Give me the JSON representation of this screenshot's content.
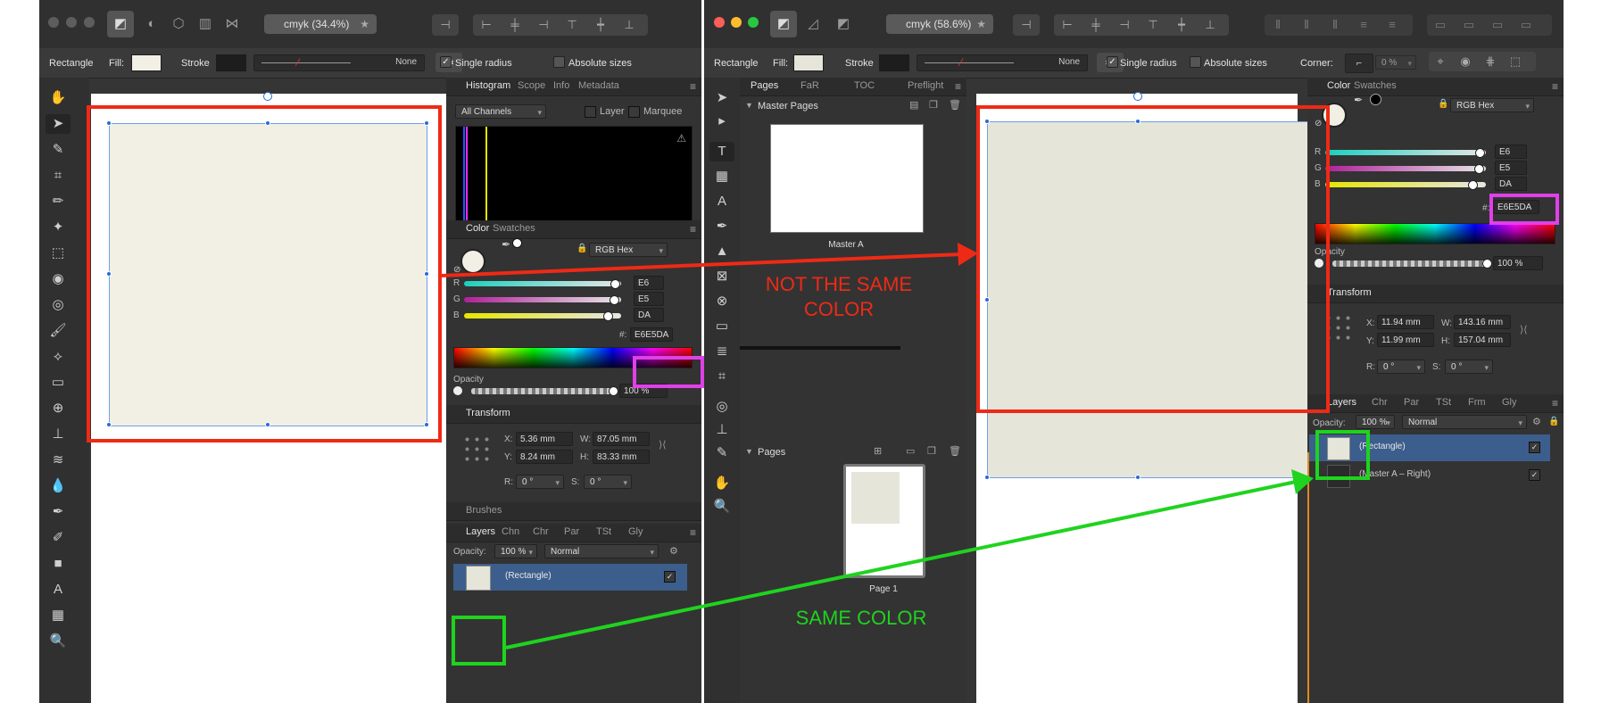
{
  "left_window": {
    "doc_tab": "cmyk (34.4%)",
    "context_bar": {
      "shape": "Rectangle",
      "fill_label": "Fill:",
      "stroke_label": "Stroke",
      "stroke_none": "None",
      "single_radius": "Single radius",
      "absolute_sizes": "Absolute sizes"
    },
    "histogram_panel": {
      "tabs": [
        "Histogram",
        "Scope",
        "Info",
        "Metadata"
      ],
      "channels": "All Channels",
      "layer_label": "Layer",
      "marquee_label": "Marquee"
    },
    "color_panel": {
      "tabs": [
        "Color",
        "Swatches"
      ],
      "mode": "RGB Hex",
      "r_label": "R",
      "g_label": "G",
      "b_label": "B",
      "r": "E6",
      "g": "E5",
      "b": "DA",
      "hex_prefix": "#:",
      "hex": "E6E5DA",
      "opacity_label": "Opacity",
      "opacity": "100 %"
    },
    "transform_panel": {
      "title": "Transform",
      "x_label": "X:",
      "x": "5.36 mm",
      "y_label": "Y:",
      "y": "8.24 mm",
      "w_label": "W:",
      "w": "87.05 mm",
      "h_label": "H:",
      "h": "83.33 mm",
      "r_label": "R:",
      "r": "0 °",
      "s_label": "S:",
      "s": "0 °"
    },
    "brushes_title": "Brushes",
    "layers_panel": {
      "tabs": [
        "Layers",
        "Chn",
        "Chr",
        "Par",
        "TSt",
        "Gly"
      ],
      "opacity_label": "Opacity:",
      "opacity": "100 %",
      "blend": "Normal",
      "rows": [
        {
          "name": "(Rectangle)"
        }
      ]
    }
  },
  "right_window": {
    "doc_tab": "cmyk (58.6%)",
    "context_bar": {
      "shape": "Rectangle",
      "fill_label": "Fill:",
      "stroke_label": "Stroke",
      "stroke_none": "None",
      "single_radius": "Single radius",
      "absolute_sizes": "Absolute sizes",
      "corner_label": "Corner:",
      "corner_value": "0 %"
    },
    "pages_panel": {
      "tabs": [
        "Pages",
        "FaR",
        "TOC",
        "Preflight"
      ],
      "master_section": "Master Pages",
      "master_name": "Master A",
      "pages_section": "Pages",
      "page_name": "Page 1"
    },
    "color_panel": {
      "tabs": [
        "Color",
        "Swatches"
      ],
      "mode": "RGB Hex",
      "r_label": "R",
      "g_label": "G",
      "b_label": "B",
      "r": "E6",
      "g": "E5",
      "b": "DA",
      "hex_prefix": "#:",
      "hex": "E6E5DA",
      "opacity_label": "Opacity",
      "opacity": "100 %"
    },
    "transform_panel": {
      "title": "Transform",
      "x_label": "X:",
      "x": "11.94 mm",
      "y_label": "Y:",
      "y": "11.99 mm",
      "w_label": "W:",
      "w": "143.16 mm",
      "h_label": "H:",
      "h": "157.04 mm",
      "r_label": "R:",
      "r": "0 °",
      "s_label": "S:",
      "s": "0 °"
    },
    "layers_panel": {
      "tabs": [
        "Layers",
        "Chr",
        "Par",
        "TSt",
        "Frm",
        "Gly"
      ],
      "opacity_label": "Opacity:",
      "opacity": "100 %",
      "blend": "Normal",
      "rows": [
        {
          "name": "(Rectangle)"
        },
        {
          "name": "(Master A – Right)"
        }
      ]
    }
  },
  "annotations": {
    "not_same_line1": "NOT THE SAME",
    "not_same_line2": "COLOR",
    "same": "SAME COLOR"
  },
  "colors": {
    "fill_left": "#f2f0e4",
    "fill_right": "#e6e5da",
    "red": "#ee2a16",
    "green": "#1fd31f",
    "magenta": "#e040e8",
    "selection": "#3c5e8c"
  }
}
